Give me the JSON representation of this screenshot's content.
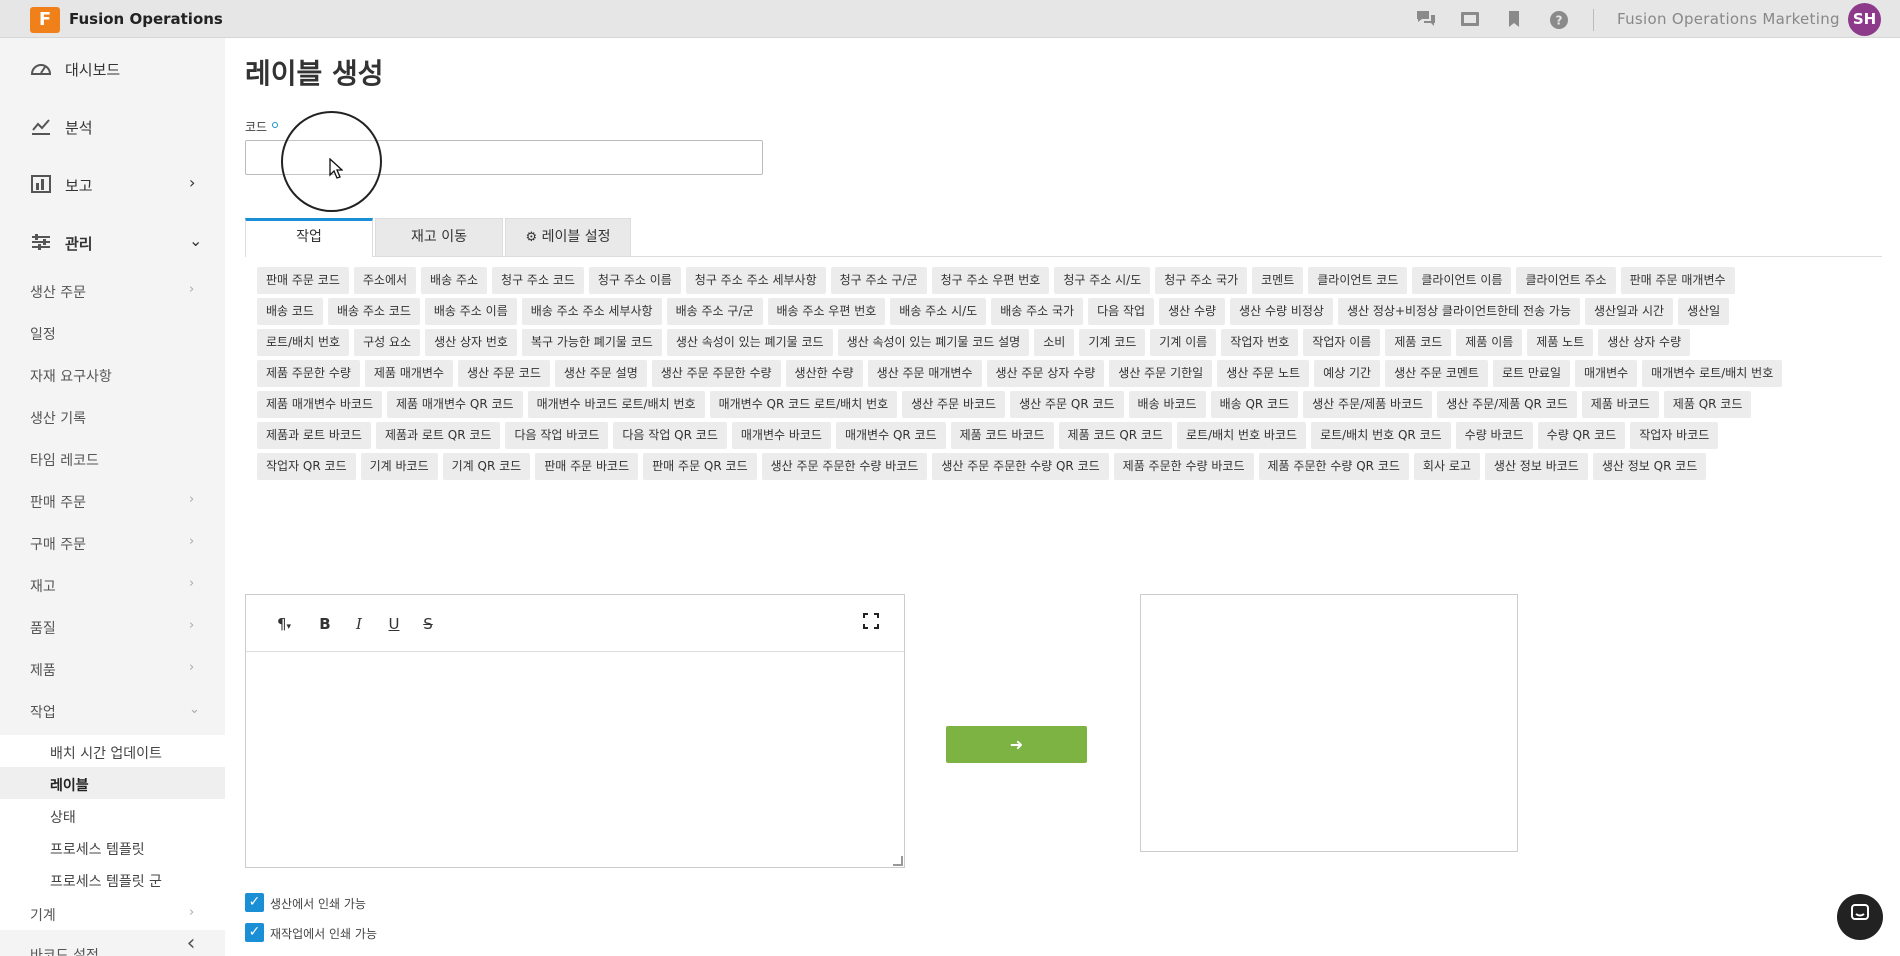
{
  "app": {
    "logo_letter": "F",
    "title": "Fusion Operations"
  },
  "header": {
    "org_name": "Fusion Operations Marketing",
    "avatar_initials": "SH",
    "icons": [
      "chat-icon",
      "media-icon",
      "bookmark-icon",
      "help-icon"
    ]
  },
  "sidebar": {
    "main": [
      {
        "label": "대시보드",
        "icon": "dashboard-icon"
      },
      {
        "label": "분석",
        "icon": "analytics-icon"
      },
      {
        "label": "보고",
        "icon": "report-icon",
        "chevron": "›"
      },
      {
        "label": "관리",
        "icon": "settings-sliders-icon",
        "chevron": "⌄"
      }
    ],
    "sub": [
      {
        "label": "생산 주문",
        "chevron": "›"
      },
      {
        "label": "일정"
      },
      {
        "label": "자재 요구사항"
      },
      {
        "label": "생산 기록"
      },
      {
        "label": "타임 레코드"
      },
      {
        "label": "판매 주문",
        "chevron": "›"
      },
      {
        "label": "구매 주문",
        "chevron": "›"
      },
      {
        "label": "재고",
        "chevron": "›"
      },
      {
        "label": "품질",
        "chevron": "›"
      },
      {
        "label": "제품",
        "chevron": "›"
      },
      {
        "label": "작업",
        "chevron": "⌄"
      }
    ],
    "work_items": [
      "배치 시간 업데이트",
      "레이블",
      "상태",
      "프로세스 템플릿",
      "프로세스 템플릿 군"
    ],
    "after": [
      {
        "label": "기계",
        "chevron": "›"
      },
      {
        "label": "바코드 설정"
      }
    ],
    "collapse": "‹"
  },
  "main": {
    "title": "레이블 생성",
    "code_label": "코드",
    "code_value": "",
    "tabs": [
      "작업",
      "재고 이동",
      "레이블 설정"
    ],
    "chips": [
      "판매 주문 코드",
      "주소에서",
      "배송 주소",
      "청구 주소 코드",
      "청구 주소 이름",
      "청구 주소 주소 세부사항",
      "청구 주소 구/군",
      "청구 주소 우편 번호",
      "청구 주소 시/도",
      "청구 주소 국가",
      "코멘트",
      "클라이언트 코드",
      "클라이언트 이름",
      "클라이언트 주소",
      "판매 주문 매개변수",
      "배송 코드",
      "배송 주소 코드",
      "배송 주소 이름",
      "배송 주소 주소 세부사항",
      "배송 주소 구/군",
      "배송 주소 우편 번호",
      "배송 주소 시/도",
      "배송 주소 국가",
      "다음 작업",
      "생산 수량",
      "생산 수량 비정상",
      "생산 정상+비정상 클라이언트한테 전송 가능",
      "생산일과 시간",
      "생산일",
      "로트/배치 번호",
      "구성 요소",
      "생산 상자 번호",
      "복구 가능한 폐기물 코드",
      "생산 속성이 있는 폐기물 코드",
      "생산 속성이 있는 폐기물 코드 설명",
      "소비",
      "기계 코드",
      "기계 이름",
      "작업자 번호",
      "작업자 이름",
      "제품 코드",
      "제품 이름",
      "제품 노트",
      "생산 상자 수량",
      "제품 주문한 수량",
      "제품 매개변수",
      "생산 주문 코드",
      "생산 주문 설명",
      "생산 주문 주문한 수량",
      "생산한 수량",
      "생산 주문 매개변수",
      "생산 주문 상자 수량",
      "생산 주문 기한일",
      "생산 주문 노트",
      "예상 기간",
      "생산 주문 코멘트",
      "로트 만료일",
      "매개변수",
      "매개변수 로트/배치 번호",
      "제품 매개변수 바코드",
      "제품 매개변수 QR 코드",
      "매개변수 바코드 로트/배치 번호",
      "매개변수 QR 코드 로트/배치 번호",
      "생산 주문 바코드",
      "생산 주문 QR 코드",
      "배송 바코드",
      "배송 QR 코드",
      "생산 주문/제품 바코드",
      "생산 주문/제품 QR 코드",
      "제품 바코드",
      "제품 QR 코드",
      "제품과 로트 바코드",
      "제품과 로트 QR 코드",
      "다음 작업 바코드",
      "다음 작업 QR 코드",
      "매개변수 바코드",
      "매개변수 QR 코드",
      "제품 코드 바코드",
      "제품 코드 QR 코드",
      "로트/배치 번호 바코드",
      "로트/배치 번호 QR 코드",
      "수량 바코드",
      "수량 QR 코드",
      "작업자 바코드",
      "작업자 QR 코드",
      "기계 바코드",
      "기계 QR 코드",
      "판매 주문 바코드",
      "판매 주문 QR 코드",
      "생산 주문 주문한 수량 바코드",
      "생산 주문 주문한 수량 QR 코드",
      "제품 주문한 수량 바코드",
      "제품 주문한 수량 QR 코드",
      "회사 로고",
      "생산 정보 바코드",
      "생산 정보 QR 코드"
    ],
    "editor_toolbar": {
      "paragraph": "¶",
      "bold": "B",
      "italic": "I",
      "underline": "U",
      "strike": "S",
      "fullscreen": "⛶"
    },
    "go_button": "➜",
    "checkboxes": [
      {
        "label": "생산에서 인쇄 가능",
        "checked": true
      },
      {
        "label": "재작업에서 인쇄 가능",
        "checked": true
      }
    ]
  },
  "colors": {
    "accent": "#1a8fd6",
    "logo": "#f0801a",
    "go": "#7cb342",
    "avatar": "#8e3a8a"
  }
}
